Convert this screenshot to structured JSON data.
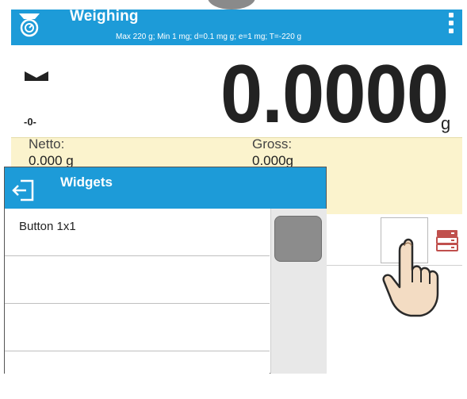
{
  "header": {
    "title": "Weighing",
    "subtitle": "Max 220 g; Min 1 mg; d=0.1 mg g; e=1 mg; T=-220 g",
    "scale_icon": "scale-icon",
    "menu_icon": "kebab-menu-icon",
    "background": "#1d9bd8"
  },
  "readout": {
    "value": "0.0000",
    "unit": "g",
    "stable_icon": "stable-indicator-icon",
    "zero_indicator": "-0-"
  },
  "info": {
    "netto_label": "Netto:",
    "netto_value": "0.000 g",
    "gross_label": "Gross:",
    "gross_value": "0.000g",
    "background": "#fbf3cd"
  },
  "widgets_strip": {
    "database_icon": "database-icon",
    "hand_icon": "pointing-hand-icon"
  },
  "dialog": {
    "title": "Widgets",
    "back_icon": "back-arrow-icon",
    "items": [
      {
        "label": "Button 1x1"
      },
      {
        "label": ""
      },
      {
        "label": ""
      },
      {
        "label": ""
      }
    ]
  }
}
